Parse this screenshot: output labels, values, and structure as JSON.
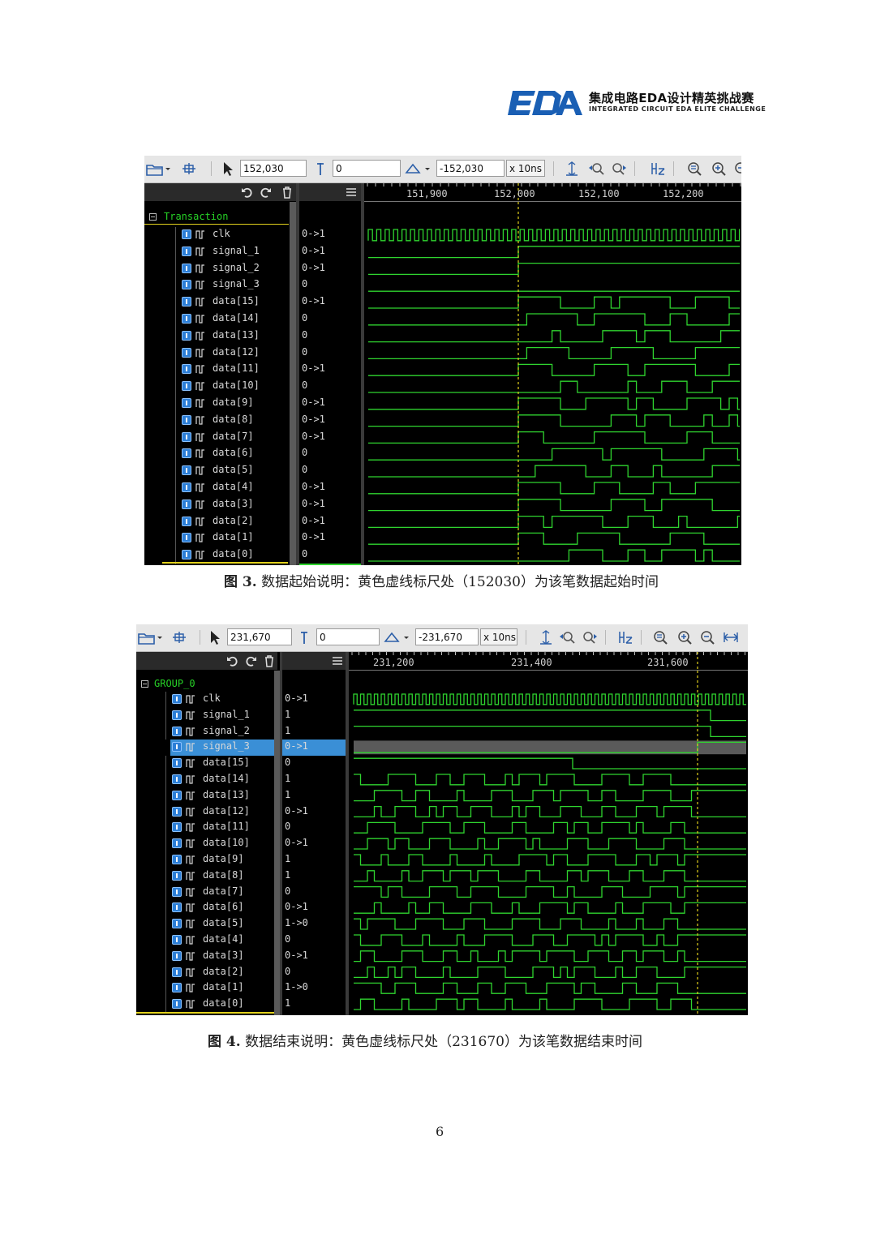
{
  "header": {
    "logo_mark": "EDA",
    "logo_title": "集成电路EDA设计精英挑战赛",
    "logo_subtitle": "INTEGRATED CIRCUIT EDA ELITE CHALLENGE"
  },
  "colors": {
    "wave": "#2fd42f",
    "cursor": "#e2d21c",
    "select": "#3a8fd6"
  },
  "figures": [
    {
      "toolbar": {
        "cursor_time": "152,030",
        "marker_time": "0",
        "delta_time": "-152,030",
        "unit": "x 10ns"
      },
      "timescale_labels": [
        "151,900",
        "152,000",
        "152,100",
        "152,200"
      ],
      "group": "Transaction",
      "signals": [
        {
          "name": "clk",
          "value": "0->1"
        },
        {
          "name": "signal_1",
          "value": "0->1"
        },
        {
          "name": "signal_2",
          "value": "0->1"
        },
        {
          "name": "signal_3",
          "value": "0"
        },
        {
          "name": "data[15]",
          "value": "0->1"
        },
        {
          "name": "data[14]",
          "value": "0"
        },
        {
          "name": "data[13]",
          "value": "0"
        },
        {
          "name": "data[12]",
          "value": "0"
        },
        {
          "name": "data[11]",
          "value": "0->1"
        },
        {
          "name": "data[10]",
          "value": "0"
        },
        {
          "name": "data[9]",
          "value": "0->1"
        },
        {
          "name": "data[8]",
          "value": "0->1"
        },
        {
          "name": "data[7]",
          "value": "0->1"
        },
        {
          "name": "data[6]",
          "value": "0"
        },
        {
          "name": "data[5]",
          "value": "0"
        },
        {
          "name": "data[4]",
          "value": "0->1"
        },
        {
          "name": "data[3]",
          "value": "0->1"
        },
        {
          "name": "data[2]",
          "value": "0->1"
        },
        {
          "name": "data[1]",
          "value": "0->1"
        },
        {
          "name": "data[0]",
          "value": "0"
        }
      ],
      "caption_label": "图 3.",
      "caption_text": "数据起始说明：黄色虚线标尺处（152030）为该笔数据起始时间"
    },
    {
      "toolbar": {
        "cursor_time": "231,670",
        "marker_time": "0",
        "delta_time": "-231,670",
        "unit": "x 10ns"
      },
      "timescale_labels": [
        "231,200",
        "231,400",
        "231,600"
      ],
      "group": "GROUP_0",
      "signals": [
        {
          "name": "clk",
          "value": "0->1"
        },
        {
          "name": "signal_1",
          "value": "1"
        },
        {
          "name": "signal_2",
          "value": "1"
        },
        {
          "name": "signal_3",
          "value": "0->1",
          "selected": true
        },
        {
          "name": "data[15]",
          "value": "0"
        },
        {
          "name": "data[14]",
          "value": "1"
        },
        {
          "name": "data[13]",
          "value": "1"
        },
        {
          "name": "data[12]",
          "value": "0->1"
        },
        {
          "name": "data[11]",
          "value": "0"
        },
        {
          "name": "data[10]",
          "value": "0->1"
        },
        {
          "name": "data[9]",
          "value": "1"
        },
        {
          "name": "data[8]",
          "value": "1"
        },
        {
          "name": "data[7]",
          "value": "0"
        },
        {
          "name": "data[6]",
          "value": "0->1"
        },
        {
          "name": "data[5]",
          "value": "1->0"
        },
        {
          "name": "data[4]",
          "value": "0"
        },
        {
          "name": "data[3]",
          "value": "0->1"
        },
        {
          "name": "data[2]",
          "value": "0"
        },
        {
          "name": "data[1]",
          "value": "1->0"
        },
        {
          "name": "data[0]",
          "value": "1"
        }
      ],
      "caption_label": "图 4.",
      "caption_text": "数据结束说明：黄色虚线标尺处（231670）为该笔数据结束时间"
    }
  ],
  "page_number": "6"
}
